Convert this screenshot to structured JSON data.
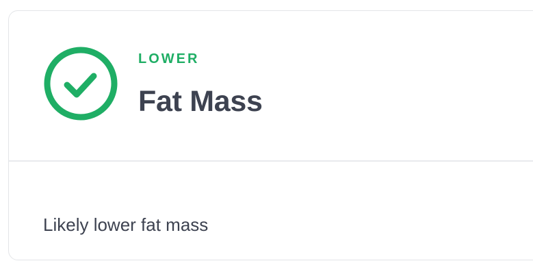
{
  "card": {
    "status_label": "LOWER",
    "status_icon": "check-circle-icon",
    "status_color": "#1fae65",
    "title": "Fat Mass",
    "description": "Likely lower fat mass"
  }
}
